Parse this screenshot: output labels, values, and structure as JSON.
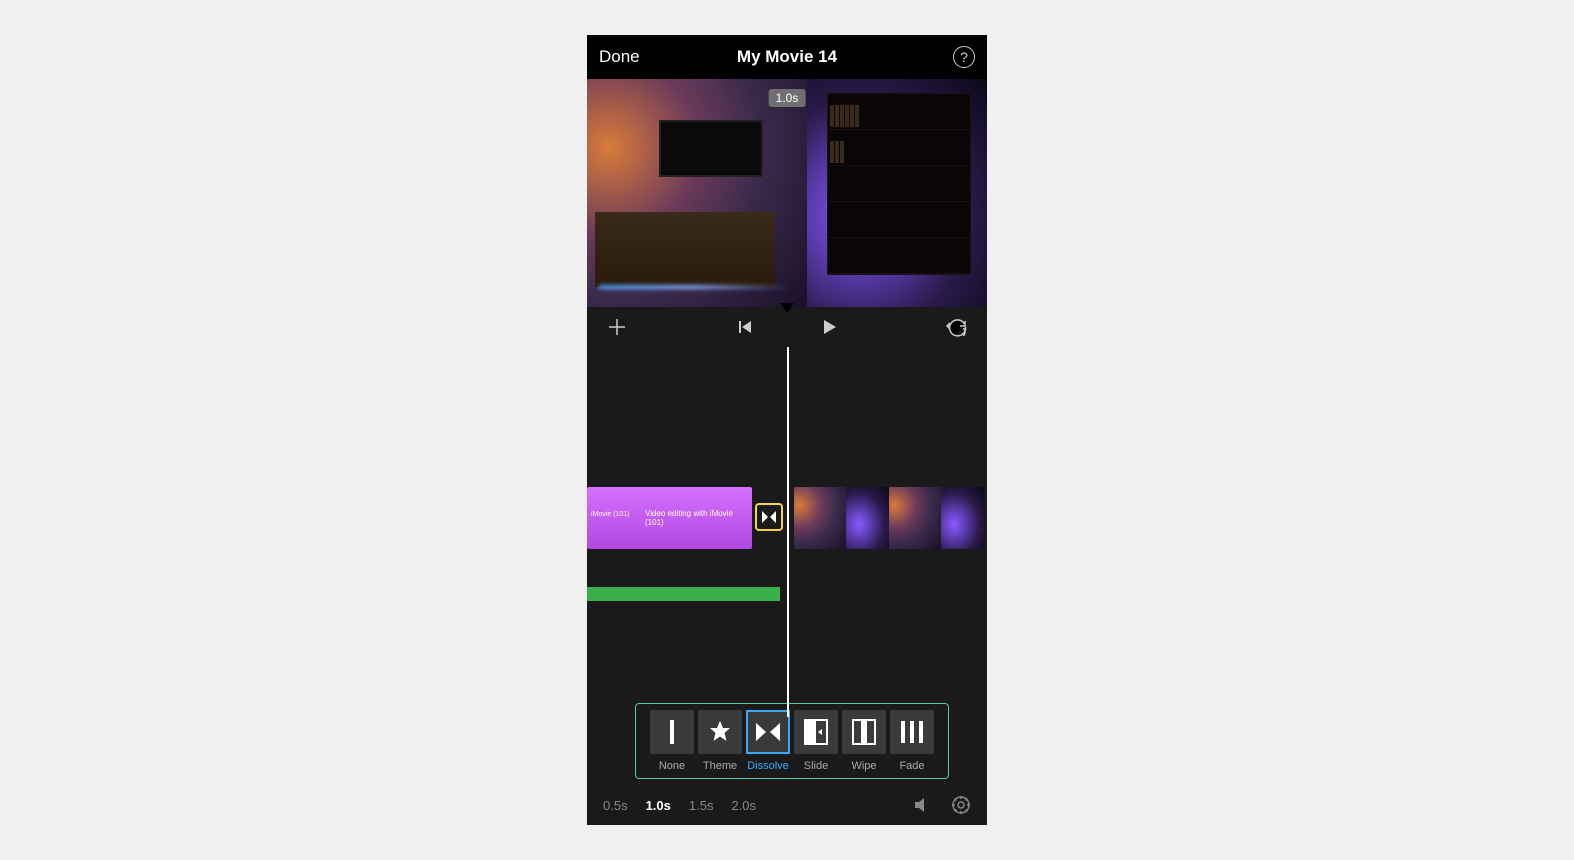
{
  "header": {
    "done": "Done",
    "title": "My Movie 14",
    "help": "?"
  },
  "preview": {
    "duration_badge": "1.0s"
  },
  "timeline": {
    "title_clip_line1": "iMovie (101)",
    "title_clip_line2": "Video editing with iMovie (101)"
  },
  "transitions": {
    "items": [
      {
        "key": "none",
        "label": "None"
      },
      {
        "key": "theme",
        "label": "Theme"
      },
      {
        "key": "dissolve",
        "label": "Dissolve"
      },
      {
        "key": "slide",
        "label": "Slide"
      },
      {
        "key": "wipe",
        "label": "Wipe"
      },
      {
        "key": "fade",
        "label": "Fade"
      }
    ],
    "selected": "dissolve"
  },
  "durations": {
    "options": [
      "0.5s",
      "1.0s",
      "1.5s",
      "2.0s"
    ],
    "active": "1.0s"
  }
}
